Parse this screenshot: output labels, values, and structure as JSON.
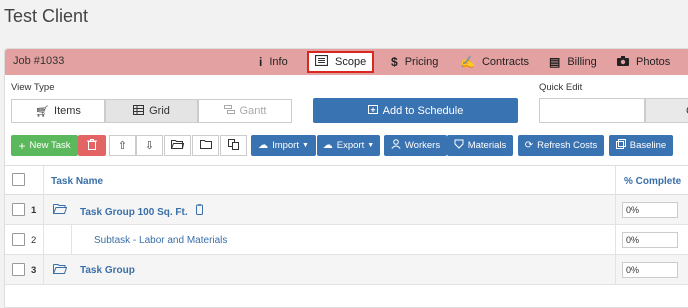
{
  "client": {
    "title": "Test Client"
  },
  "jobbar": {
    "job_number": "Job #1033",
    "tabs": [
      {
        "label": "Info",
        "icon": "info-icon"
      },
      {
        "label": "Scope",
        "icon": "list-icon"
      },
      {
        "label": "Pricing",
        "icon": "dollar-icon"
      },
      {
        "label": "Contracts",
        "icon": "signature-icon"
      },
      {
        "label": "Billing",
        "icon": "receipt-icon"
      },
      {
        "label": "Photos",
        "icon": "camera-icon"
      }
    ],
    "active_tab": "Scope"
  },
  "view_type": {
    "label": "View Type",
    "options": [
      {
        "label": "Items",
        "icon": "cart-icon"
      },
      {
        "label": "Grid",
        "icon": "table-icon"
      },
      {
        "label": "Gantt",
        "icon": "gantt-icon"
      }
    ],
    "selected": "Grid"
  },
  "schedule": {
    "label": "Add to Schedule"
  },
  "quick_edit": {
    "label": "Quick Edit",
    "button": "C"
  },
  "toolbar": {
    "new_task": "New Task",
    "import": "Import",
    "export": "Export",
    "workers": "Workers",
    "materials": "Materials",
    "refresh_costs": "Refresh Costs",
    "baseline": "Baseline"
  },
  "grid": {
    "headers": {
      "task_name": "Task Name",
      "percent_complete": "% Complete"
    },
    "rows": [
      {
        "num": "1",
        "name": "Task Group 100 Sq. Ft.",
        "pct": "0%"
      },
      {
        "num": "2",
        "name": "Subtask - Labor and Materials",
        "pct": "0%"
      },
      {
        "num": "3",
        "name": "Task Group",
        "pct": "0%"
      }
    ]
  },
  "colors": {
    "jobbar": "#e4a1a1",
    "primary": "#3a73b2",
    "success": "#5cb85c",
    "danger": "#e26464",
    "active_border": "#d9281f"
  }
}
